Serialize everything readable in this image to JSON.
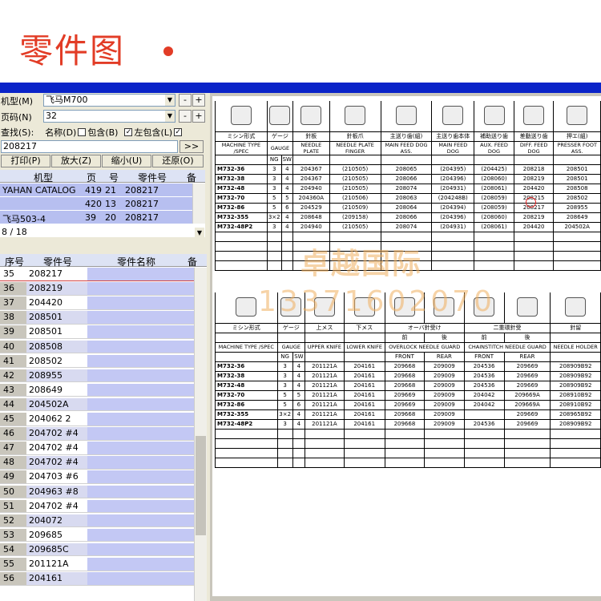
{
  "header": {
    "title": "零件图"
  },
  "left": {
    "model_label": "机型(M)",
    "model_value": "飞马M700",
    "page_label": "页码(N)",
    "page_value": "32",
    "search_label": "查找(S):",
    "name_label": "名称(D)",
    "contains_label": "包含(B)",
    "left_contains_label": "左包含(L)",
    "search_value": "208217",
    "go": ">>",
    "buttons": {
      "print": "打印(P)",
      "zoom_in": "放大(Z)",
      "zoom_out": "缩小(U)",
      "restore": "还原(O)"
    },
    "pm": {
      "minus": "-",
      "plus": "+"
    },
    "check": "✓",
    "grid1": {
      "headers": [
        "机型",
        "页",
        "号",
        "零件号",
        "备"
      ],
      "rows": [
        [
          "YAHAN CATALOG",
          "419",
          "21",
          "208217"
        ],
        [
          "",
          "420",
          "13",
          "208217"
        ],
        [
          "飞马503-4",
          "39",
          "20",
          "208217"
        ]
      ],
      "status": "8 / 18"
    },
    "grid2": {
      "headers": [
        "序号",
        "零件号",
        "零件名称",
        "备"
      ],
      "rows": [
        [
          "35",
          "208217"
        ],
        [
          "36",
          "208219"
        ],
        [
          "37",
          "204420"
        ],
        [
          "38",
          "208501"
        ],
        [
          "39",
          "208501"
        ],
        [
          "40",
          "208508"
        ],
        [
          "41",
          "208502"
        ],
        [
          "42",
          "208955"
        ],
        [
          "43",
          "208649"
        ],
        [
          "44",
          "204502A"
        ],
        [
          "45",
          "204062 2"
        ],
        [
          "46",
          "204702 #4"
        ],
        [
          "47",
          "204702 #4"
        ],
        [
          "48",
          "204702 #4"
        ],
        [
          "49",
          "204703 #6"
        ],
        [
          "50",
          "204963 #8"
        ],
        [
          "51",
          "204702 #4"
        ],
        [
          "52",
          "204072"
        ],
        [
          "53",
          "209685"
        ],
        [
          "54",
          "209685C"
        ],
        [
          "55",
          "201121A"
        ],
        [
          "56",
          "204161"
        ]
      ]
    }
  },
  "table1": {
    "jp": [
      "ミシン形式",
      "ゲージ",
      "",
      "針板",
      "針板爪",
      "主送り歯(組)",
      "主送り歯本体",
      "補助送り歯",
      "差動送り歯",
      "押エ(組)"
    ],
    "en": [
      "MACHINE TYPE /SPEC",
      "GAUGE",
      "",
      "NEEDLE PLATE",
      "NEEDLE PLATE FINGER",
      "MAIN FEED DOG ASS.",
      "MAIN FEED DOG",
      "AUX. FEED DOG",
      "DIFF. FEED DOG",
      "PRESSER FOOT ASS."
    ],
    "sub": [
      "",
      "NG",
      "SW"
    ],
    "rows": [
      [
        "M732-36",
        "3",
        "4",
        "204367",
        "(210505)",
        "208065",
        "(204395)",
        "(204425)",
        "208218",
        "208501"
      ],
      [
        "M732-38",
        "3",
        "4",
        "204367",
        "(210505)",
        "208066",
        "(204396)",
        "(208060)",
        "208219",
        "208501"
      ],
      [
        "M732-48",
        "3",
        "4",
        "204940",
        "(210505)",
        "208074",
        "(204931)",
        "(208061)",
        "204420",
        "208508"
      ],
      [
        "M732-70",
        "5",
        "5",
        "204360A",
        "(210506)",
        "208063",
        "(204248B)",
        "(208059)",
        "208215",
        "208502"
      ],
      [
        "M732-86",
        "5",
        "6",
        "204529",
        "(210509)",
        "208064",
        "(204394)",
        "(208059)",
        "208217",
        "208955"
      ],
      [
        "M732-355",
        "3×2",
        "4",
        "208648",
        "(209158)",
        "208066",
        "(204396)",
        "(208060)",
        "208219",
        "208649"
      ],
      [
        "M732-48P2",
        "3",
        "4",
        "204940",
        "(210505)",
        "208074",
        "(204931)",
        "(208061)",
        "204420",
        "204502A"
      ]
    ]
  },
  "table2": {
    "jp": [
      "ミシン形式",
      "ゲージ",
      "",
      "上メス",
      "下メス",
      "オーバ針受け",
      "",
      "二重環針受",
      "",
      "針留"
    ],
    "jp2": [
      "",
      "",
      "",
      "",
      "",
      "前",
      "後",
      "前",
      "後",
      ""
    ],
    "en": [
      "MACHINE TYPE /SPEC",
      "GAUGE",
      "",
      "UPPER KNIFE",
      "LOWER KNIFE",
      "OVERLOCK NEEDLE GUARD",
      "",
      "CHAINSTITCH NEEDLE GUARD",
      "",
      "NEEDLE HOLDER"
    ],
    "sub": [
      "",
      "NG",
      "SW",
      "",
      "",
      "FRONT",
      "REAR",
      "FRONT",
      "REAR",
      ""
    ],
    "rows": [
      [
        "M732-36",
        "3",
        "4",
        "201121A",
        "204161",
        "209668",
        "209009",
        "204536",
        "209669",
        "208909B92"
      ],
      [
        "M732-38",
        "3",
        "4",
        "201121A",
        "204161",
        "209668",
        "209009",
        "204536",
        "209669",
        "208909B92"
      ],
      [
        "M732-48",
        "3",
        "4",
        "201121A",
        "204161",
        "209668",
        "209009",
        "204536",
        "209669",
        "208909B92"
      ],
      [
        "M732-70",
        "5",
        "5",
        "201121A",
        "204161",
        "209669",
        "209009",
        "204042",
        "209669A",
        "208910B92"
      ],
      [
        "M732-86",
        "5",
        "6",
        "201121A",
        "204161",
        "209669",
        "209009",
        "204042",
        "209669A",
        "208910B92"
      ],
      [
        "M732-355",
        "3×2",
        "4",
        "201121A",
        "204161",
        "209668",
        "209009",
        "",
        "209669",
        "208965B92"
      ],
      [
        "M732-48P2",
        "3",
        "4",
        "201121A",
        "204161",
        "209668",
        "209009",
        "204536",
        "209669",
        "208909B92"
      ]
    ]
  },
  "watermark": {
    "line1": "卓越国际",
    "line2": "13371602070"
  },
  "colors": {
    "title": "#e23c26",
    "bar": "#0a23c8",
    "selection": "#b7bff0"
  }
}
